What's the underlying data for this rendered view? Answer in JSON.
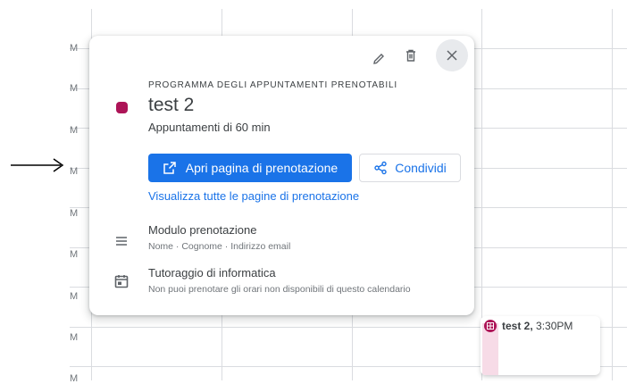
{
  "time_labels": [
    "M",
    "M",
    "M",
    "M",
    "M",
    "M",
    "M",
    "M",
    "M"
  ],
  "popup": {
    "eyebrow": "PROGRAMMA DEGLI APPUNTAMENTI PRENOTABILI",
    "title": "test 2",
    "subtitle": "Appuntamenti di 60 min",
    "primary_button": "Apri pagina di prenotazione",
    "share_button": "Condividi",
    "view_all_link": "Visualizza tutte le pagine di prenotazione",
    "form": {
      "title": "Modulo prenotazione",
      "fields": "Nome · Cognome · Indirizzo email"
    },
    "calendar": {
      "title": "Tutoraggio di informatica",
      "note": "Non puoi prenotare gli orari non disponibili di questo calendario"
    }
  },
  "event_chip": {
    "title": "test 2,",
    "time": "3:30PM"
  },
  "colors": {
    "accent": "#1a73e8",
    "event": "#ad1457"
  }
}
